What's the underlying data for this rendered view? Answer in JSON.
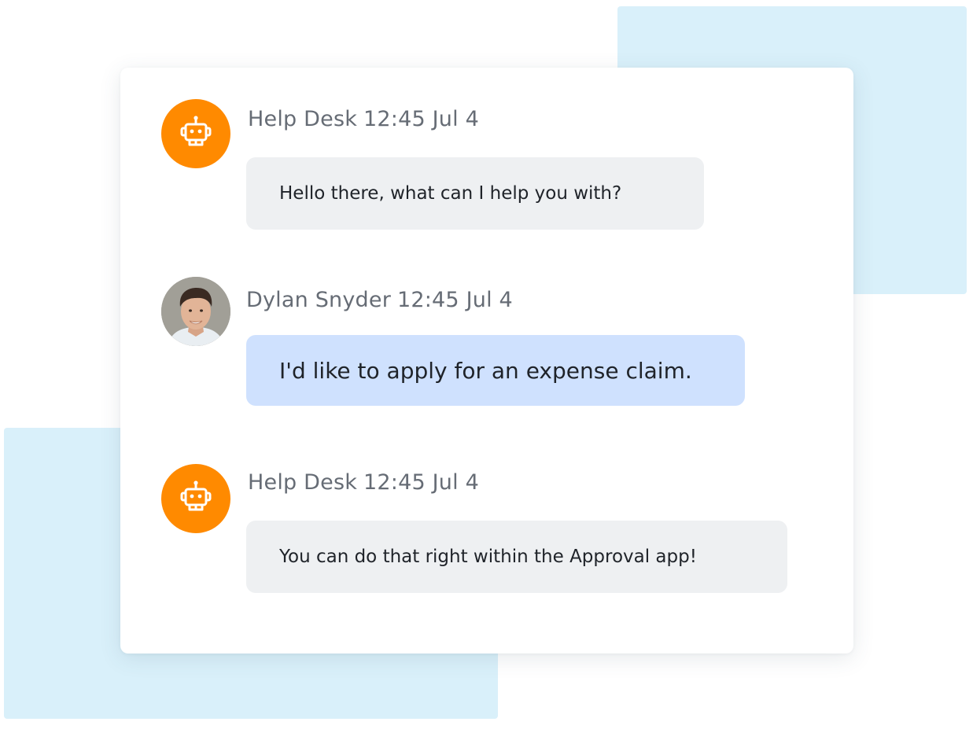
{
  "colors": {
    "bot_avatar": "#ff8a00",
    "bot_bubble": "#eef0f2",
    "user_bubble": "#cfe1fe",
    "decor": "#d9f0fa"
  },
  "messages": [
    {
      "sender": "Help Desk",
      "time": "12:45 Jul 4",
      "text": "Hello there, what can I help you with?",
      "avatar_icon": "robot-icon"
    },
    {
      "sender": "Dylan Snyder",
      "time": "12:45 Jul 4",
      "text": "I'd like to apply for an expense claim.",
      "avatar_icon": "user-photo"
    },
    {
      "sender": "Help Desk",
      "time": "12:45 Jul 4",
      "text": "You can do that right within the Approval app!",
      "avatar_icon": "robot-icon"
    }
  ]
}
